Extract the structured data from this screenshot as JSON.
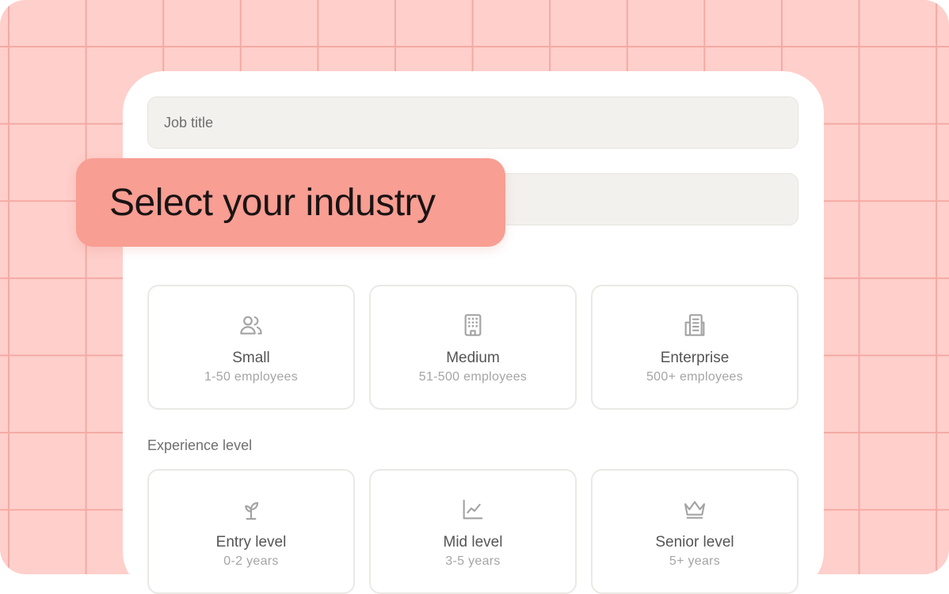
{
  "form": {
    "job_title_placeholder": "Job title",
    "industry_placeholder": ""
  },
  "tooltip": {
    "text": "Select your industry"
  },
  "company_size": {
    "options": [
      {
        "title": "Small",
        "subtitle": "1-50 employees",
        "icon": "users-icon"
      },
      {
        "title": "Medium",
        "subtitle": "51-500 employees",
        "icon": "building-icon"
      },
      {
        "title": "Enterprise",
        "subtitle": "500+ employees",
        "icon": "office-building-icon"
      }
    ]
  },
  "experience": {
    "label": "Experience level",
    "options": [
      {
        "title": "Entry level",
        "subtitle": "0-2 years",
        "icon": "sprout-icon"
      },
      {
        "title": "Mid level",
        "subtitle": "3-5 years",
        "icon": "line-chart-icon"
      },
      {
        "title": "Senior level",
        "subtitle": "5+ years",
        "icon": "crown-icon"
      }
    ]
  },
  "colors": {
    "background": "#ffcfcb",
    "grid_lines": "#f4aaa4",
    "tooltip": "#f89e93",
    "field_bg": "#f3f1ed",
    "icon": "#a3a3a3"
  }
}
